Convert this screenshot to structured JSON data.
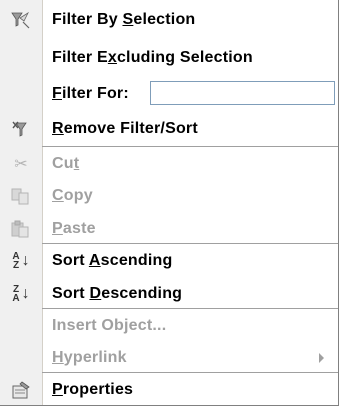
{
  "menu": {
    "filter_by_selection": {
      "pre": "Filter By ",
      "key": "S",
      "post": "election"
    },
    "filter_excluding_selection": {
      "pre": "Filter E",
      "key": "x",
      "post": "cluding Selection"
    },
    "filter_for": {
      "pre": "",
      "key": "F",
      "post": "ilter For:",
      "value": ""
    },
    "remove_filter_sort": {
      "pre": "",
      "key": "R",
      "post": "emove Filter/Sort"
    },
    "cut": {
      "pre": "Cu",
      "key": "t",
      "post": ""
    },
    "copy": {
      "pre": "",
      "key": "C",
      "post": "opy"
    },
    "paste": {
      "pre": "",
      "key": "P",
      "post": "aste"
    },
    "sort_ascending": {
      "pre": "Sort ",
      "key": "A",
      "post": "scending",
      "glyph_top": "A",
      "glyph_bottom": "Z"
    },
    "sort_descending": {
      "pre": "Sort ",
      "key": "D",
      "post": "escending",
      "glyph_top": "Z",
      "glyph_bottom": "A"
    },
    "insert_object": {
      "label": "Insert Object..."
    },
    "hyperlink": {
      "pre": "",
      "key": "H",
      "post": "yperlink"
    },
    "properties": {
      "pre": "",
      "key": "P",
      "post": "roperties"
    }
  },
  "icons": {
    "cut": "✂",
    "arrow_down": "↓"
  },
  "colors": {
    "disabled_text": "#a0a0a0",
    "input_border": "#7f9db9",
    "gutter": "#f0f0f0"
  }
}
